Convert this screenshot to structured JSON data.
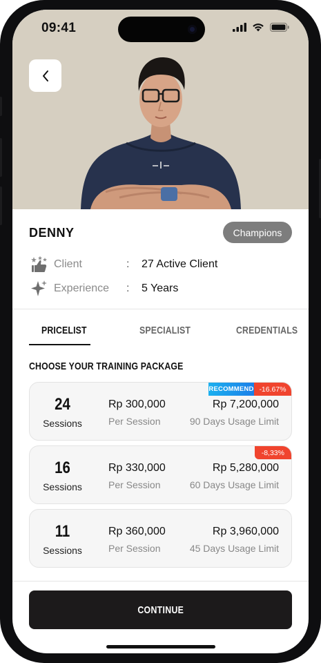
{
  "status_bar": {
    "time": "09:41"
  },
  "profile": {
    "name": "DENNY",
    "badge": "Champions",
    "client_label": "Client",
    "client_value": "27 Active Client",
    "experience_label": "Experience",
    "experience_value": "5 Years",
    "separator": ":"
  },
  "tabs": [
    {
      "label": "PRICELIST",
      "active": true
    },
    {
      "label": "SPECIALIST",
      "active": false
    },
    {
      "label": "CREDENTIALS",
      "active": false
    }
  ],
  "section_title": "CHOOSE YOUR TRAINING PACKAGE",
  "packages": [
    {
      "sessions": "24",
      "unit": "Sessions",
      "price": "Rp 300,000",
      "price_note": "Per Session",
      "total": "Rp 7,200,000",
      "limit": "90 Days Usage Limit",
      "recommend": "RECOMMEND",
      "discount": "-16.67%"
    },
    {
      "sessions": "16",
      "unit": "Sessions",
      "price": "Rp 330,000",
      "price_note": "Per Session",
      "total": "Rp 5,280,000",
      "limit": "60 Days Usage Limit",
      "discount": "-8,33%"
    },
    {
      "sessions": "11",
      "unit": "Sessions",
      "price": "Rp 360,000",
      "price_note": "Per Session",
      "total": "Rp 3,960,000",
      "limit": "45 Days Usage Limit"
    }
  ],
  "continue_label": "CONTINUE",
  "colors": {
    "hero_bg": "#d6cfc1",
    "badge_bg": "#7d7d7d",
    "button_bg": "#1c1a1b",
    "recommend_blue": "#1b9ff0",
    "discount_red": "#f0442e"
  },
  "icons": [
    "back-chevron-icon",
    "signal-icon",
    "wifi-icon",
    "battery-icon",
    "thumbs-up-stars-icon",
    "sparkle-icon"
  ]
}
